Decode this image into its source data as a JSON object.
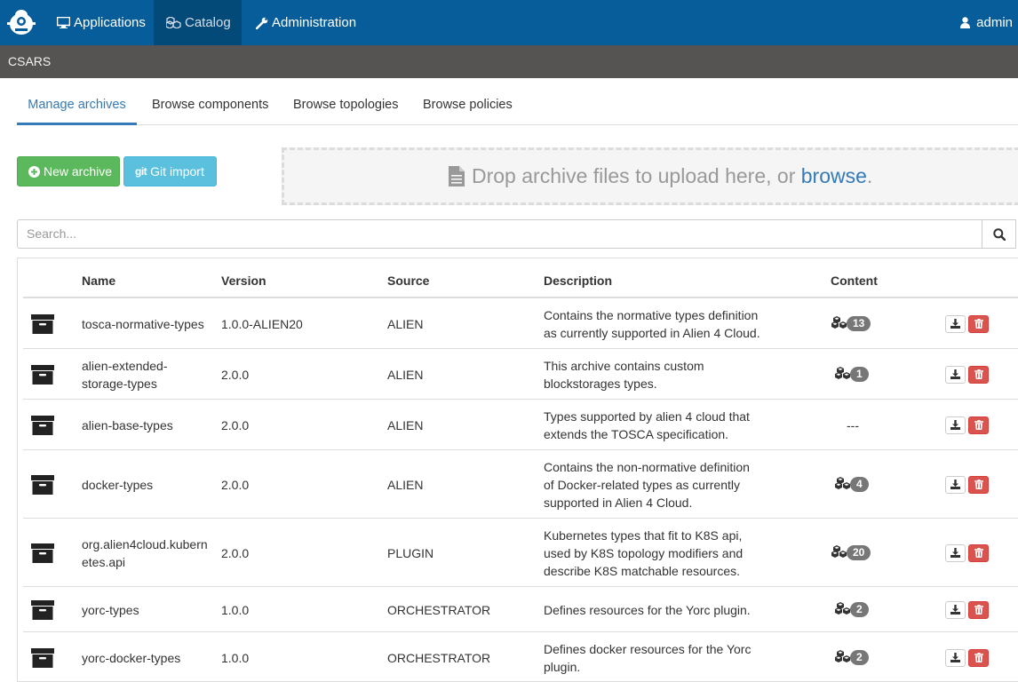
{
  "nav": {
    "applications": "Applications",
    "catalog": "Catalog",
    "administration": "Administration",
    "user": "admin"
  },
  "subheader": {
    "title": "CSARS"
  },
  "tabs": [
    {
      "label": "Manage archives",
      "active": true
    },
    {
      "label": "Browse components"
    },
    {
      "label": "Browse topologies"
    },
    {
      "label": "Browse policies"
    }
  ],
  "actions": {
    "new_archive": "New archive",
    "git_mark": "git",
    "git_import": "Git import"
  },
  "dropzone": {
    "text": "Drop archive files to upload here, or ",
    "browse": "browse",
    "period": "."
  },
  "search": {
    "placeholder": "Search..."
  },
  "table": {
    "headers": {
      "name": "Name",
      "version": "Version",
      "source": "Source",
      "description": "Description",
      "content": "Content"
    },
    "rows": [
      {
        "name": [
          "tosca-normative-types"
        ],
        "version": "1.0.0-ALIEN20",
        "source": "ALIEN",
        "description": [
          "Contains the normative types definition",
          "as currently supported in Alien 4 Cloud."
        ],
        "content": "13"
      },
      {
        "name": [
          "alien-extended-",
          "storage-types"
        ],
        "version": "2.0.0",
        "source": "ALIEN",
        "description": [
          "This archive contains custom",
          "blockstorages types."
        ],
        "content": "1"
      },
      {
        "name": [
          "alien-base-types"
        ],
        "version": "2.0.0",
        "source": "ALIEN",
        "description": [
          "Types supported by alien 4 cloud that",
          "extends the TOSCA specification."
        ],
        "content": "---"
      },
      {
        "name": [
          "docker-types"
        ],
        "version": "2.0.0",
        "source": "ALIEN",
        "description": [
          "Contains the non-normative definition",
          "of Docker-related types as currently",
          "supported in Alien 4 Cloud."
        ],
        "content": "4"
      },
      {
        "name": [
          "org.alien4cloud.kubern",
          "etes.api"
        ],
        "version": "2.0.0",
        "source": "PLUGIN",
        "description": [
          "Kubernetes types that fit to K8S api,",
          "used by K8S topology modifiers and",
          "describe K8S matchable resources."
        ],
        "content": "20"
      },
      {
        "name": [
          "yorc-types"
        ],
        "version": "1.0.0",
        "source": "ORCHESTRATOR",
        "description": [
          "Defines resources for the Yorc plugin."
        ],
        "content": "2"
      },
      {
        "name": [
          "yorc-docker-types"
        ],
        "version": "1.0.0",
        "source": "ORCHESTRATOR",
        "description": [
          "Defines docker resources for the Yorc",
          "plugin."
        ],
        "content": "2"
      }
    ]
  },
  "colors": {
    "navbar": "#075d9a",
    "subheader": "#555453",
    "primary": "#337ab7",
    "success": "#5cb85c",
    "info": "#5bc0de",
    "danger": "#d9534f"
  },
  "icons": [
    "logo-icon",
    "desktop-icon",
    "cubes-icon",
    "wrench-icon",
    "user-icon",
    "plus-circle-icon",
    "file-icon",
    "search-icon",
    "archive-icon",
    "download-icon",
    "trash-icon"
  ]
}
